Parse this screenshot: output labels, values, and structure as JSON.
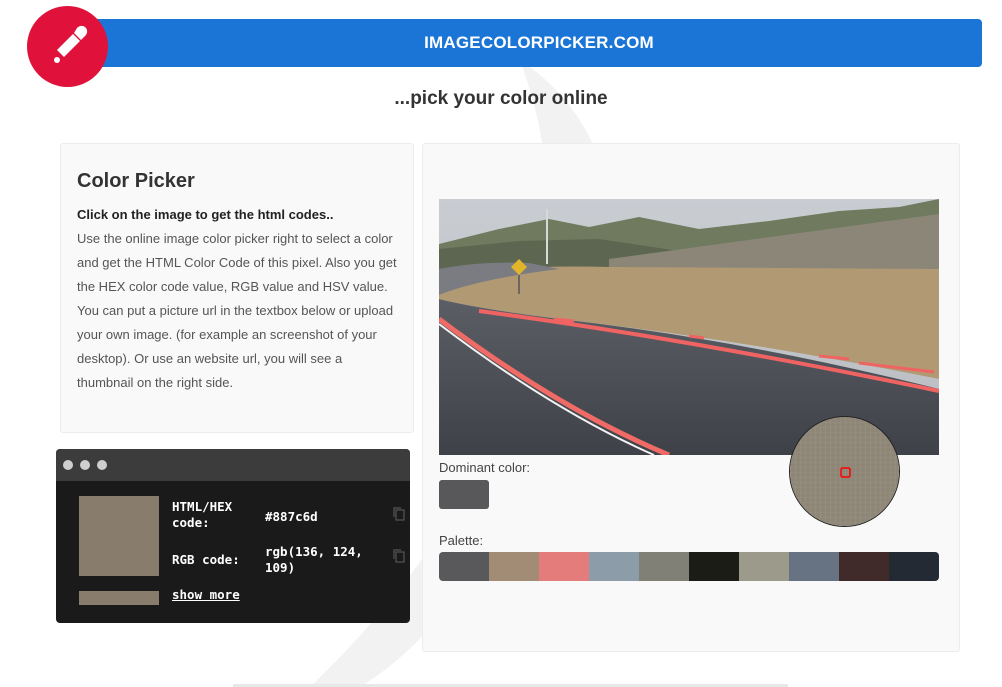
{
  "header": {
    "title": "IMAGECOLORPICKER.COM",
    "logo_icon": "eyedropper-icon"
  },
  "tagline": "...pick your color online",
  "info": {
    "title": "Color Picker",
    "lead": "Click on the image to get the html codes..",
    "body": "Use the online image color picker right to select a color and get the HTML Color Code of this pixel. Also you get the HEX color code value, RGB value and HSV value. You can put a picture url in the textbox below or upload your own image. (for example an screenshot of your desktop). Or use an website url, you will see a thumbnail on the right side."
  },
  "result": {
    "color": "#887c6d",
    "hex_label": "HTML/HEX code:",
    "hex_value": "#887c6d",
    "rgb_label": "RGB code:",
    "rgb_value": "rgb(136, 124, 109)",
    "show_more": "show more"
  },
  "image_panel": {
    "dominant_label": "Dominant color:",
    "dominant_color": "#58585a",
    "palette_label": "Palette:",
    "palette": [
      "#59585b",
      "#a28c76",
      "#e47c7b",
      "#8d9ca9",
      "#808077",
      "#1c1c17",
      "#9c9b8b",
      "#677283",
      "#412a2a",
      "#232a33"
    ]
  },
  "colors": {
    "brand_blue": "#1b75d6",
    "brand_red": "#e0123c"
  }
}
